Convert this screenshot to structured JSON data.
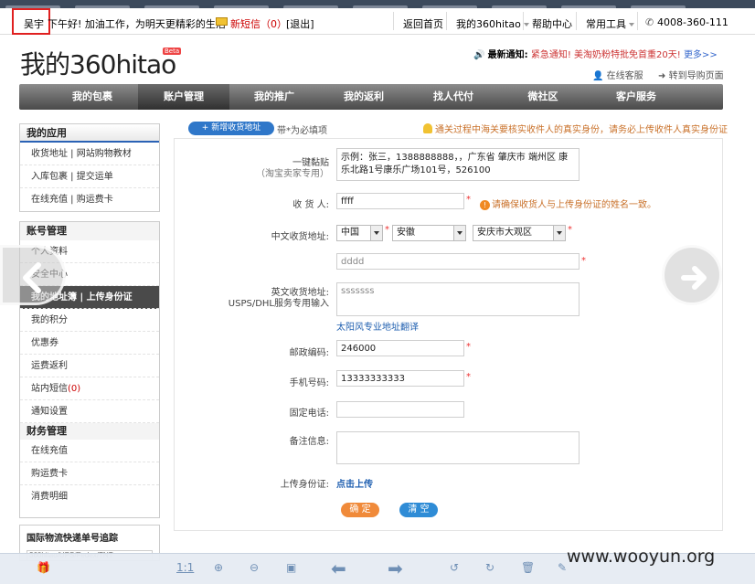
{
  "topbar": {
    "user": "吴宇",
    "greeting": "下午好! 加油工作，为明天更精彩的生活",
    "sms": "新短信（0）",
    "logout": "[退出]",
    "links": [
      "返回首页",
      "我的360hitao",
      "帮助中心",
      "常用工具"
    ],
    "phone": "4008-360-111"
  },
  "header": {
    "logo_text": "我的360hitao",
    "beta": "Beta",
    "notice_label": "最新通知:",
    "notice_text": "紧急通知! 美淘奶粉特批免首重20天!",
    "notice_more": "更多>>",
    "online_service": "在线客服",
    "guide_link": "转到导购页面"
  },
  "mainnav": [
    "我的包裹",
    "账户管理",
    "我的推广",
    "我的返利",
    "找人代付",
    "微社区",
    "客户服务"
  ],
  "sidebar": {
    "apps_title": "我的应用",
    "apps": [
      "收货地址 | 网站购物教材",
      "入库包裹 | 提交运单",
      "在线充值 | 购运费卡"
    ],
    "account_title": "账号管理",
    "account_items": [
      "个人资料",
      "安全中心",
      "我的地址簿 | 上传身份证",
      "我的积分",
      "优惠券",
      "运费返利",
      "站内短信",
      "通知设置"
    ],
    "sms_count": "(0)",
    "finance_title": "财务管理",
    "finance_items": [
      "在线充值",
      "购运费卡",
      "消费明细"
    ],
    "track_title": "国际物流快递单号追踪",
    "track_placeholder": "360hitao/UPS/Fedex/TNT"
  },
  "form": {
    "add_button": "+ 新增收货地址",
    "required_note": "带*为必填项",
    "warning": "通关过程中海关要核实收件人的真实身份，请务必上传收件人真实身份证",
    "paste_label": "一键黏贴",
    "paste_sub": "（淘宝卖家专用）",
    "paste_value": "示例：张三，1388888888，，广东省 肇庆市 端州区 康乐北路1号康乐广场101号，526100",
    "receiver_label": "收 货 人:",
    "receiver_value": "ffff",
    "receiver_hint": "请确保收货人与上传身份证的姓名一致。",
    "cn_addr_label": "中文收货地址:",
    "country": "中国",
    "province": "安徽",
    "city": "安庆市大观区",
    "street_value": "dddd",
    "en_addr_label": "英文收货地址:",
    "en_addr_sub": "USPS/DHL服务专用输入",
    "en_addr_value": "sssssss",
    "translate_link": "太阳风专业地址翻译",
    "zip_label": "邮政编码:",
    "zip_value": "246000",
    "mobile_label": "手机号码:",
    "mobile_value": "13333333333",
    "phone_label": "固定电话:",
    "phone_value": "",
    "remark_label": "备注信息:",
    "remark_value": "",
    "id_label": "上传身份证:",
    "id_link": "点击上传",
    "ok": "确 定",
    "clear": "清 空"
  },
  "viewer": {
    "ratio": "1:1",
    "watermark": "www.wooyun.org"
  }
}
